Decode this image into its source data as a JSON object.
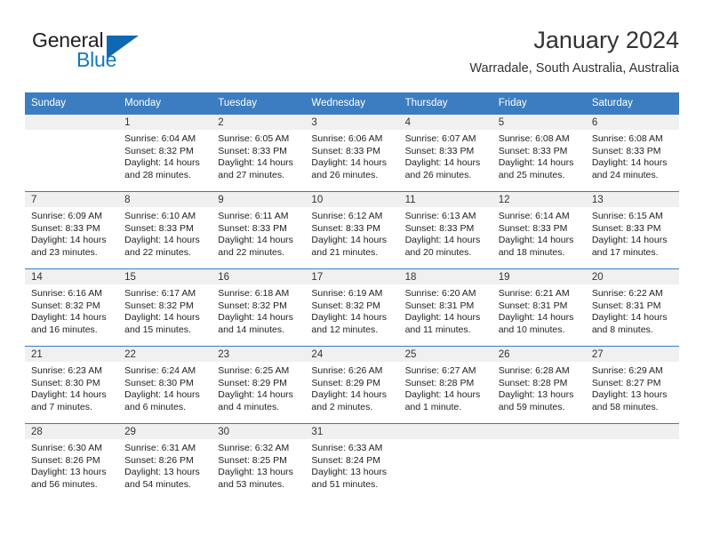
{
  "brand": {
    "name_part1": "General",
    "name_part2": "Blue",
    "logo_icon": "triangle-flag-icon"
  },
  "header": {
    "title": "January 2024",
    "subtitle": "Warradale, South Australia, Australia"
  },
  "colors": {
    "header_blue": "#3b7dc0",
    "brand_blue": "#1279c0",
    "daynum_band": "#f0f0f0",
    "text": "#222222"
  },
  "calendar": {
    "weekday_headers": [
      "Sunday",
      "Monday",
      "Tuesday",
      "Wednesday",
      "Thursday",
      "Friday",
      "Saturday"
    ],
    "weeks": [
      [
        {
          "day": "",
          "sunrise": "",
          "sunset": "",
          "daylight_line1": "",
          "daylight_line2": ""
        },
        {
          "day": "1",
          "sunrise": "Sunrise: 6:04 AM",
          "sunset": "Sunset: 8:32 PM",
          "daylight_line1": "Daylight: 14 hours",
          "daylight_line2": "and 28 minutes."
        },
        {
          "day": "2",
          "sunrise": "Sunrise: 6:05 AM",
          "sunset": "Sunset: 8:33 PM",
          "daylight_line1": "Daylight: 14 hours",
          "daylight_line2": "and 27 minutes."
        },
        {
          "day": "3",
          "sunrise": "Sunrise: 6:06 AM",
          "sunset": "Sunset: 8:33 PM",
          "daylight_line1": "Daylight: 14 hours",
          "daylight_line2": "and 26 minutes."
        },
        {
          "day": "4",
          "sunrise": "Sunrise: 6:07 AM",
          "sunset": "Sunset: 8:33 PM",
          "daylight_line1": "Daylight: 14 hours",
          "daylight_line2": "and 26 minutes."
        },
        {
          "day": "5",
          "sunrise": "Sunrise: 6:08 AM",
          "sunset": "Sunset: 8:33 PM",
          "daylight_line1": "Daylight: 14 hours",
          "daylight_line2": "and 25 minutes."
        },
        {
          "day": "6",
          "sunrise": "Sunrise: 6:08 AM",
          "sunset": "Sunset: 8:33 PM",
          "daylight_line1": "Daylight: 14 hours",
          "daylight_line2": "and 24 minutes."
        }
      ],
      [
        {
          "day": "7",
          "sunrise": "Sunrise: 6:09 AM",
          "sunset": "Sunset: 8:33 PM",
          "daylight_line1": "Daylight: 14 hours",
          "daylight_line2": "and 23 minutes."
        },
        {
          "day": "8",
          "sunrise": "Sunrise: 6:10 AM",
          "sunset": "Sunset: 8:33 PM",
          "daylight_line1": "Daylight: 14 hours",
          "daylight_line2": "and 22 minutes."
        },
        {
          "day": "9",
          "sunrise": "Sunrise: 6:11 AM",
          "sunset": "Sunset: 8:33 PM",
          "daylight_line1": "Daylight: 14 hours",
          "daylight_line2": "and 22 minutes."
        },
        {
          "day": "10",
          "sunrise": "Sunrise: 6:12 AM",
          "sunset": "Sunset: 8:33 PM",
          "daylight_line1": "Daylight: 14 hours",
          "daylight_line2": "and 21 minutes."
        },
        {
          "day": "11",
          "sunrise": "Sunrise: 6:13 AM",
          "sunset": "Sunset: 8:33 PM",
          "daylight_line1": "Daylight: 14 hours",
          "daylight_line2": "and 20 minutes."
        },
        {
          "day": "12",
          "sunrise": "Sunrise: 6:14 AM",
          "sunset": "Sunset: 8:33 PM",
          "daylight_line1": "Daylight: 14 hours",
          "daylight_line2": "and 18 minutes."
        },
        {
          "day": "13",
          "sunrise": "Sunrise: 6:15 AM",
          "sunset": "Sunset: 8:33 PM",
          "daylight_line1": "Daylight: 14 hours",
          "daylight_line2": "and 17 minutes."
        }
      ],
      [
        {
          "day": "14",
          "sunrise": "Sunrise: 6:16 AM",
          "sunset": "Sunset: 8:32 PM",
          "daylight_line1": "Daylight: 14 hours",
          "daylight_line2": "and 16 minutes."
        },
        {
          "day": "15",
          "sunrise": "Sunrise: 6:17 AM",
          "sunset": "Sunset: 8:32 PM",
          "daylight_line1": "Daylight: 14 hours",
          "daylight_line2": "and 15 minutes."
        },
        {
          "day": "16",
          "sunrise": "Sunrise: 6:18 AM",
          "sunset": "Sunset: 8:32 PM",
          "daylight_line1": "Daylight: 14 hours",
          "daylight_line2": "and 14 minutes."
        },
        {
          "day": "17",
          "sunrise": "Sunrise: 6:19 AM",
          "sunset": "Sunset: 8:32 PM",
          "daylight_line1": "Daylight: 14 hours",
          "daylight_line2": "and 12 minutes."
        },
        {
          "day": "18",
          "sunrise": "Sunrise: 6:20 AM",
          "sunset": "Sunset: 8:31 PM",
          "daylight_line1": "Daylight: 14 hours",
          "daylight_line2": "and 11 minutes."
        },
        {
          "day": "19",
          "sunrise": "Sunrise: 6:21 AM",
          "sunset": "Sunset: 8:31 PM",
          "daylight_line1": "Daylight: 14 hours",
          "daylight_line2": "and 10 minutes."
        },
        {
          "day": "20",
          "sunrise": "Sunrise: 6:22 AM",
          "sunset": "Sunset: 8:31 PM",
          "daylight_line1": "Daylight: 14 hours",
          "daylight_line2": "and 8 minutes."
        }
      ],
      [
        {
          "day": "21",
          "sunrise": "Sunrise: 6:23 AM",
          "sunset": "Sunset: 8:30 PM",
          "daylight_line1": "Daylight: 14 hours",
          "daylight_line2": "and 7 minutes."
        },
        {
          "day": "22",
          "sunrise": "Sunrise: 6:24 AM",
          "sunset": "Sunset: 8:30 PM",
          "daylight_line1": "Daylight: 14 hours",
          "daylight_line2": "and 6 minutes."
        },
        {
          "day": "23",
          "sunrise": "Sunrise: 6:25 AM",
          "sunset": "Sunset: 8:29 PM",
          "daylight_line1": "Daylight: 14 hours",
          "daylight_line2": "and 4 minutes."
        },
        {
          "day": "24",
          "sunrise": "Sunrise: 6:26 AM",
          "sunset": "Sunset: 8:29 PM",
          "daylight_line1": "Daylight: 14 hours",
          "daylight_line2": "and 2 minutes."
        },
        {
          "day": "25",
          "sunrise": "Sunrise: 6:27 AM",
          "sunset": "Sunset: 8:28 PM",
          "daylight_line1": "Daylight: 14 hours",
          "daylight_line2": "and 1 minute."
        },
        {
          "day": "26",
          "sunrise": "Sunrise: 6:28 AM",
          "sunset": "Sunset: 8:28 PM",
          "daylight_line1": "Daylight: 13 hours",
          "daylight_line2": "and 59 minutes."
        },
        {
          "day": "27",
          "sunrise": "Sunrise: 6:29 AM",
          "sunset": "Sunset: 8:27 PM",
          "daylight_line1": "Daylight: 13 hours",
          "daylight_line2": "and 58 minutes."
        }
      ],
      [
        {
          "day": "28",
          "sunrise": "Sunrise: 6:30 AM",
          "sunset": "Sunset: 8:26 PM",
          "daylight_line1": "Daylight: 13 hours",
          "daylight_line2": "and 56 minutes."
        },
        {
          "day": "29",
          "sunrise": "Sunrise: 6:31 AM",
          "sunset": "Sunset: 8:26 PM",
          "daylight_line1": "Daylight: 13 hours",
          "daylight_line2": "and 54 minutes."
        },
        {
          "day": "30",
          "sunrise": "Sunrise: 6:32 AM",
          "sunset": "Sunset: 8:25 PM",
          "daylight_line1": "Daylight: 13 hours",
          "daylight_line2": "and 53 minutes."
        },
        {
          "day": "31",
          "sunrise": "Sunrise: 6:33 AM",
          "sunset": "Sunset: 8:24 PM",
          "daylight_line1": "Daylight: 13 hours",
          "daylight_line2": "and 51 minutes."
        },
        {
          "day": "",
          "sunrise": "",
          "sunset": "",
          "daylight_line1": "",
          "daylight_line2": ""
        },
        {
          "day": "",
          "sunrise": "",
          "sunset": "",
          "daylight_line1": "",
          "daylight_line2": ""
        },
        {
          "day": "",
          "sunrise": "",
          "sunset": "",
          "daylight_line1": "",
          "daylight_line2": ""
        }
      ]
    ]
  }
}
